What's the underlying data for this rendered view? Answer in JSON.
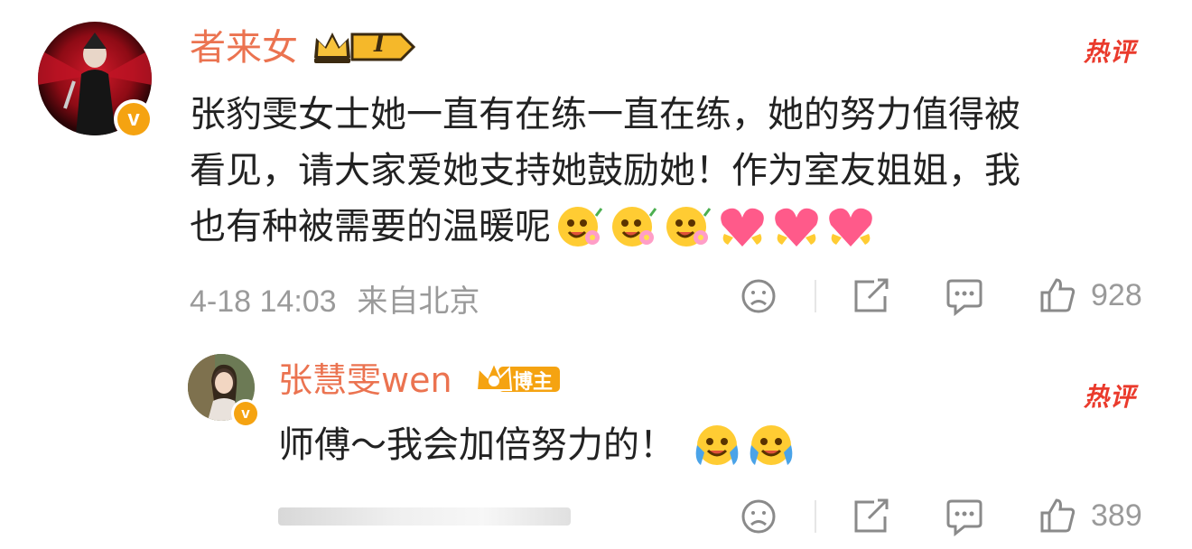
{
  "comment": {
    "username": "者来女",
    "level_badge": "I",
    "hot_label": "热评",
    "text_line1": "张豹雯女士她一直有在练一直在练，她的努力值得被",
    "text_line2": "看见，请大家爱她支持她鼓励她！作为室友姐姐，我",
    "text_line3": "也有种被需要的温暖呢",
    "timestamp": "4-18 14:03",
    "location": "来自北京",
    "like_count": "928",
    "emojis": [
      "flower-smile-emoji",
      "flower-smile-emoji",
      "flower-smile-emoji",
      "heart-emoji",
      "heart-emoji",
      "heart-emoji"
    ]
  },
  "reply": {
    "username": "张慧雯wen",
    "role_badge": "博主",
    "hot_label": "热评",
    "text": "师傅～我会加倍努力的！",
    "like_count": "389",
    "emojis": [
      "crying-smile-emoji",
      "crying-smile-emoji"
    ]
  },
  "colors": {
    "username": "#eb7350",
    "hot": "#ea3a2c",
    "meta": "#9a9a9a",
    "verified": "#f5a311"
  }
}
